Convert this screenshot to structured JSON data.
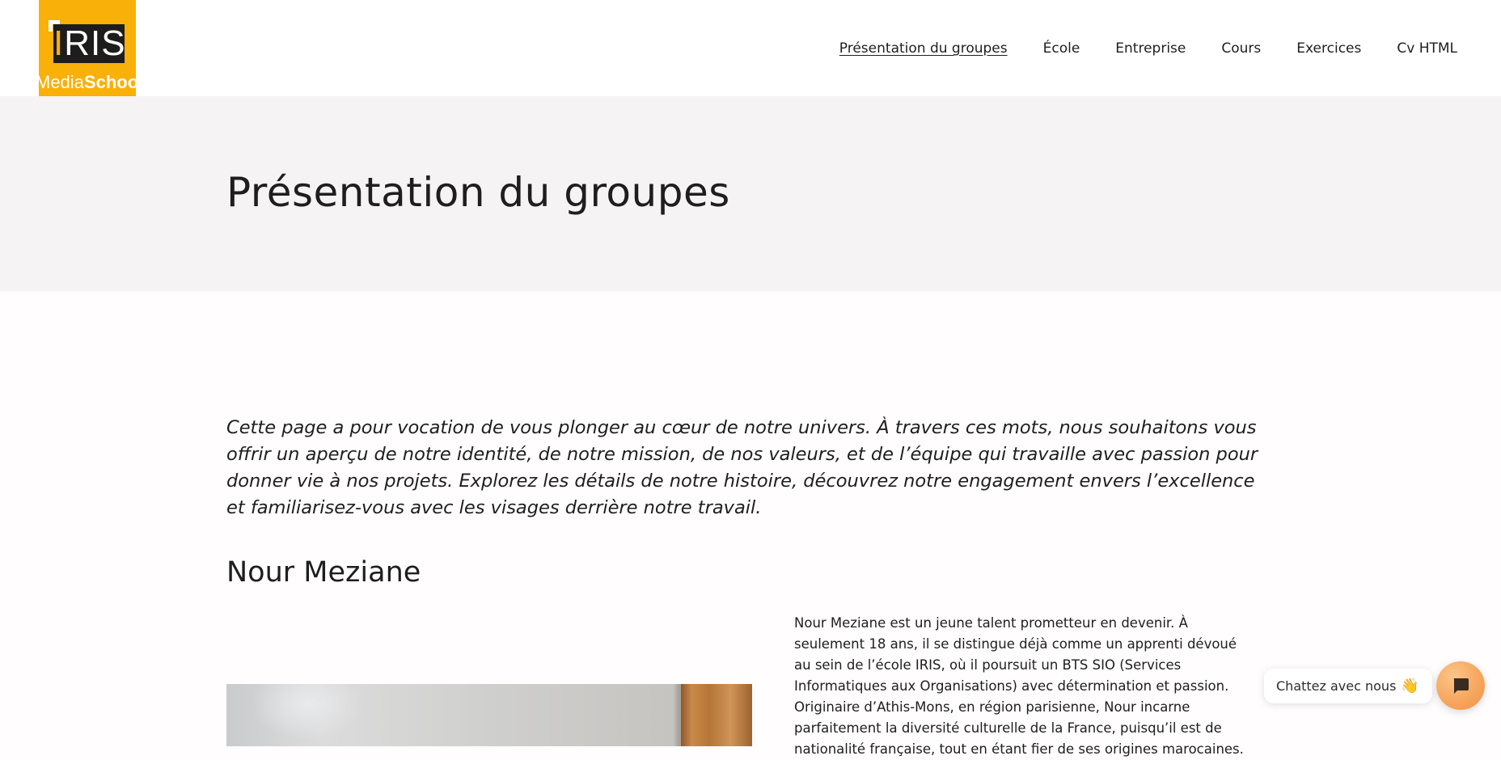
{
  "header": {
    "logo": {
      "wordmark": "IRIS",
      "sub_light": "Media",
      "sub_bold": "School"
    },
    "nav": [
      {
        "label": "Présentation du groupes",
        "active": true
      },
      {
        "label": "École"
      },
      {
        "label": "Entreprise"
      },
      {
        "label": "Cours"
      },
      {
        "label": "Exercices"
      },
      {
        "label": "Cv HTML"
      }
    ]
  },
  "hero": {
    "title": "Présentation du groupes"
  },
  "main": {
    "intro": "Cette page a pour vocation de vous plonger au cœur de notre univers. À travers ces mots, nous souhaitons vous offrir un aperçu de notre identité, de notre mission, de nos valeurs, et de l’équipe qui travaille avec passion pour donner vie à nos projets. Explorez les détails de notre histoire, découvrez notre engagement envers l’excellence et familiarisez-vous avec les visages derrière notre travail.",
    "person": {
      "name": "Nour Meziane",
      "bio": "Nour Meziane est un jeune talent prometteur en devenir. À seulement 18 ans, il se distingue déjà comme un apprenti dévoué au sein de l’école IRIS, où il poursuit un BTS SIO (Services Informatiques aux Organisations) avec détermination et passion. Originaire d’Athis-Mons, en région parisienne, Nour incarne parfaitement la diversité culturelle de la France, puisqu’il est de nationalité française, tout en étant fier de ses origines marocaines."
    }
  },
  "chat": {
    "bubble_text": "Chattez avec nous",
    "wave_emoji": "👋"
  },
  "colors": {
    "brand_yellow": "#f9b008",
    "hero_bg": "#f5f3f3",
    "chat_orange": "#f6a45b"
  }
}
